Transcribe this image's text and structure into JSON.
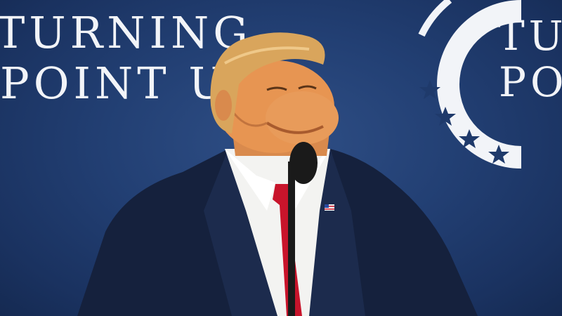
{
  "backdrop": {
    "left_line1": "TURNING",
    "left_line2": "POINT U",
    "right_line1": "TU",
    "right_line2": "PO"
  },
  "colors": {
    "background": "#1f3a6b",
    "backdrop_text": "#f2f4f8",
    "logo_star": "#1f3a6b",
    "suit": "#15213d",
    "shirt": "#f3f3f1",
    "tie": "#c8142b",
    "hair": "#d9a55c",
    "skin": "#e79552",
    "microphone": "#1a1a1a"
  },
  "logo": {
    "icon": "turning-point-ring-with-stars-icon",
    "star_count": 4
  },
  "subject": {
    "description_icon": "speaker-at-podium-figure",
    "pin_icon": "american-flag-pin-icon"
  }
}
